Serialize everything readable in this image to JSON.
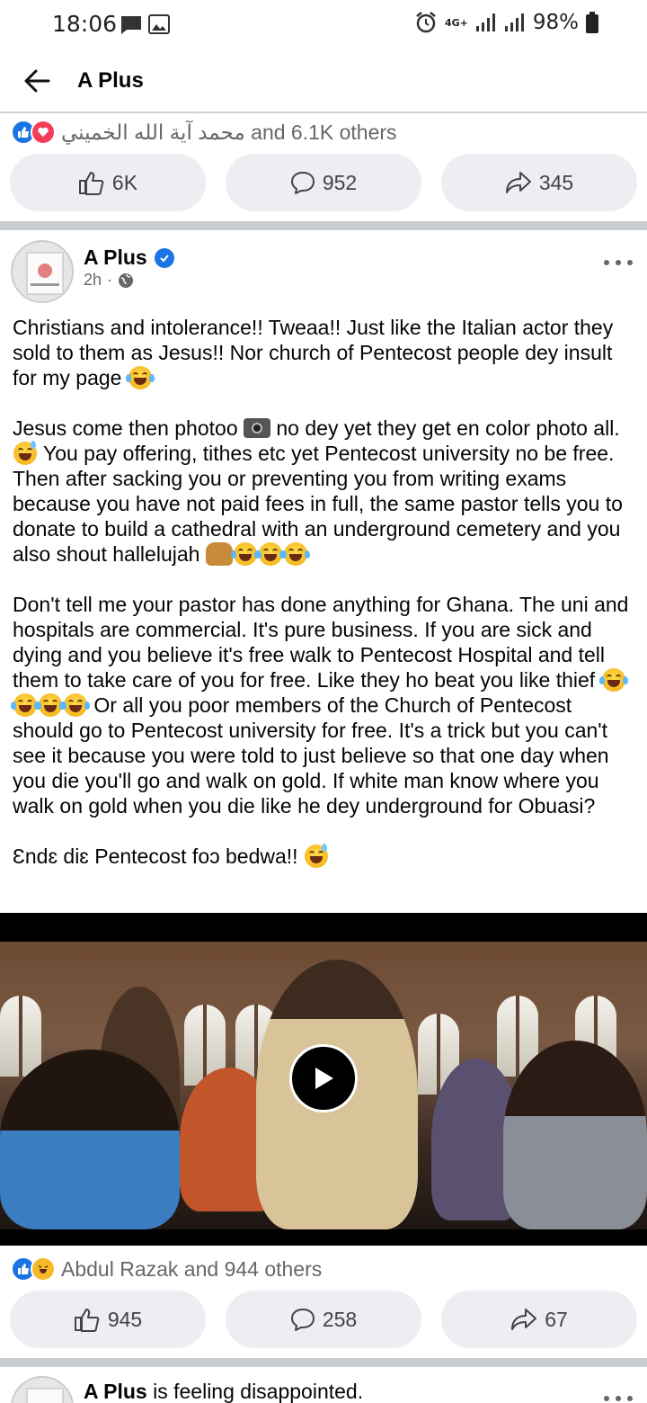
{
  "status_bar": {
    "time": "18:06",
    "network": "4G+",
    "battery": "98%"
  },
  "header": {
    "title": "A Plus"
  },
  "prev_post": {
    "reactions_text": "محمد آية الله الخميني and 6.1K others",
    "likes": "6K",
    "comments": "952",
    "shares": "345"
  },
  "post": {
    "author": "A Plus",
    "time": "2h",
    "paragraphs": {
      "p1": "Christians and intolerance!! Tweaa!! Just like the Italian actor they sold to them as Jesus!! Nor church of Pentecost people dey insult for my page",
      "p2a": "Jesus come then photoo",
      "p2b": "no dey yet they get en color photo all.",
      "p2c": "You pay offering, tithes etc yet Pentecost university no be free. Then after sacking you or preventing you from writing exams because you have not paid fees in full, the same pastor tells you to donate to build a cathedral with an underground cemetery and you also shout hallelujah",
      "p3a": "Don't tell me your pastor has done anything for Ghana. The uni and hospitals are commercial. It's pure business. If you are sick and dying and you believe it's free walk to Pentecost Hospital and tell them to take care of you for free. Like they ho beat you like thief",
      "p3b": "Or all you poor members of the Church of Pentecost should go to Pentecost university for free. It's a trick but you can't see it because you were told to just believe so that one day when you die you'll go and walk on gold. If white man know where you walk on gold when you die like he dey underground for Obuasi?",
      "p4": "Ɛndɛ diɛ Pentecost foɔ bedwa!!"
    },
    "reactions_text": "Abdul Razak and 944 others",
    "likes": "945",
    "comments": "258",
    "shares": "67"
  },
  "next_post": {
    "author": "A Plus",
    "activity": "is feeling disappointed."
  },
  "colors": {
    "like_blue": "#1b74e4",
    "love_red": "#f33e58",
    "divider": "#c9ccd1"
  }
}
